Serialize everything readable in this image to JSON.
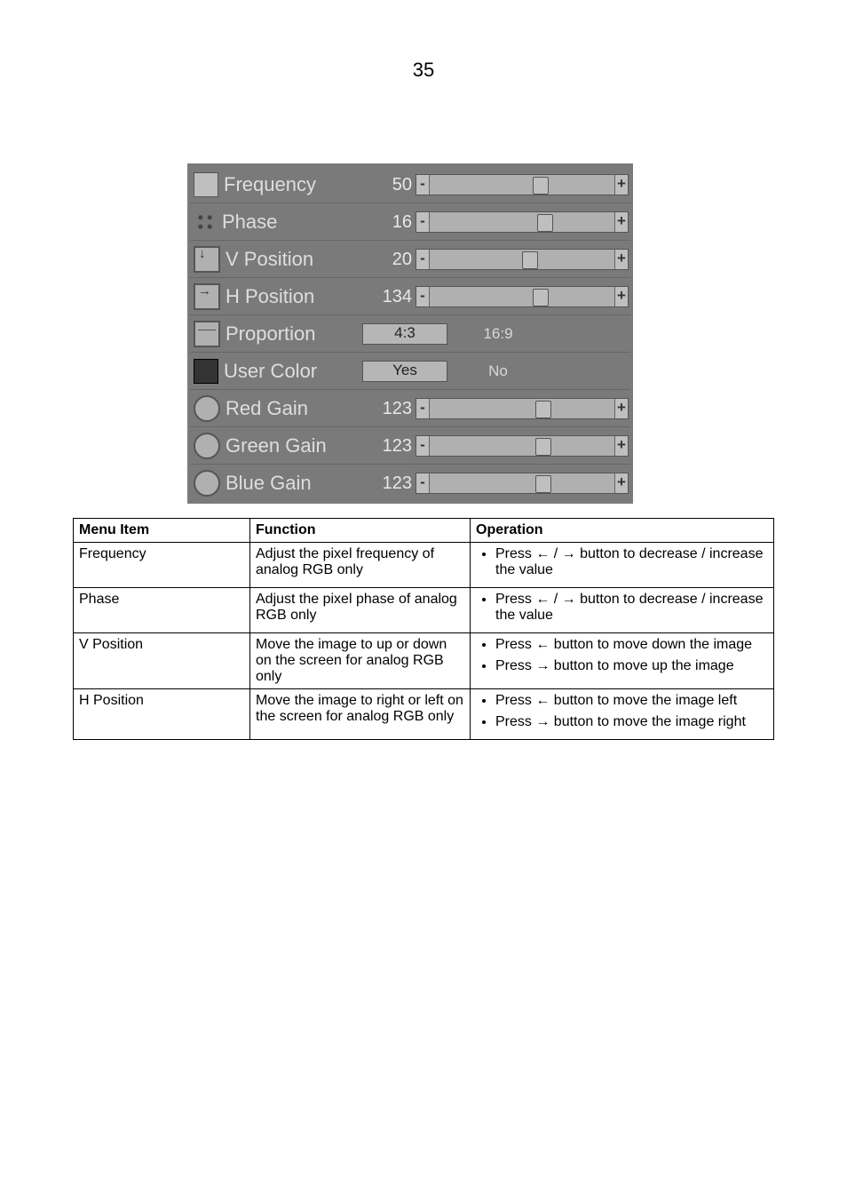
{
  "page": {
    "number": "35"
  },
  "osd": {
    "rows": [
      {
        "kind": "slider",
        "icon": "frequency-icon",
        "icls": "ic-freq",
        "label": "Frequency",
        "value": "50",
        "pct": 56
      },
      {
        "kind": "slider",
        "icon": "phase-icon",
        "icls": "ic-phase",
        "label": "Phase",
        "value": "16",
        "pct": 58
      },
      {
        "kind": "slider",
        "icon": "v-position-icon",
        "icls": "ic-vert",
        "label": "V Position",
        "value": "20",
        "pct": 50
      },
      {
        "kind": "slider",
        "icon": "h-position-icon",
        "icls": "ic-horz",
        "label": "H Position",
        "value": "134",
        "pct": 56
      },
      {
        "kind": "toggle",
        "icon": "proportion-icon",
        "icls": "ic-prop",
        "label": "Proportion",
        "selected": "4:3",
        "other": "16:9"
      },
      {
        "kind": "toggle",
        "icon": "user-color-icon",
        "icls": "ic-uc",
        "label": "User Color",
        "selected": "Yes",
        "other": "No"
      },
      {
        "kind": "slider",
        "icon": "red-gain-icon",
        "icls": "ic-rgba",
        "label": "Red Gain",
        "value": "123",
        "pct": 57
      },
      {
        "kind": "slider",
        "icon": "green-gain-icon",
        "icls": "ic-rgba",
        "label": "Green Gain",
        "value": "123",
        "pct": 57
      },
      {
        "kind": "slider",
        "icon": "blue-gain-icon",
        "icls": "ic-rgba",
        "label": "Blue Gain",
        "value": "123",
        "pct": 57
      }
    ]
  },
  "table": {
    "headers": {
      "a": "Menu Item",
      "b": "Function",
      "c": "Operation"
    },
    "rows": [
      {
        "item": "Frequency",
        "func": "Adjust the pixel frequency of analog RGB only",
        "ops": [
          "Press ← / → button to decrease / increase the value"
        ]
      },
      {
        "item": "Phase",
        "func": "Adjust the pixel phase of analog RGB only",
        "ops": [
          "Press ← / → button to decrease / increase the value"
        ]
      },
      {
        "item": "V Position",
        "func": "Move the image to up or down on the screen for analog RGB only",
        "ops": [
          "Press ← button to move down the image",
          "Press → button to move up the image"
        ]
      },
      {
        "item": "H Position",
        "func": "Move the image to right or left on the screen for analog RGB only",
        "ops": [
          "Press ← button to move the image left",
          "Press → button to move the image right"
        ]
      }
    ]
  }
}
